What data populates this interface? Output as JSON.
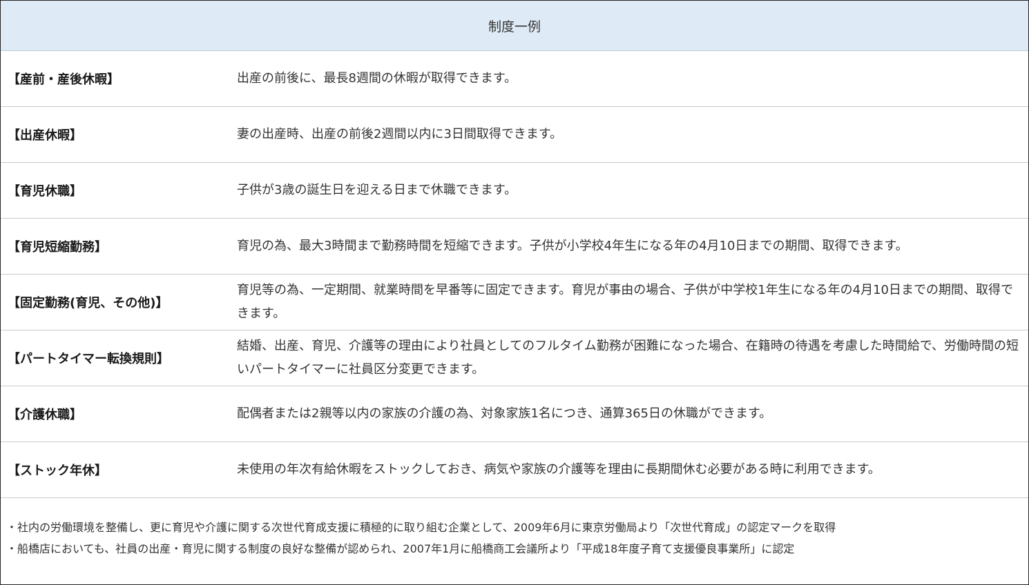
{
  "table": {
    "header": "制度一例",
    "rows": [
      {
        "name": "【産前・産後休暇】",
        "desc": "出産の前後に、最長8週間の休暇が取得できます。"
      },
      {
        "name": "【出産休暇】",
        "desc": "妻の出産時、出産の前後2週間以内に3日間取得できます。"
      },
      {
        "name": "【育児休職】",
        "desc": "子供が3歳の誕生日を迎える日まで休職できます。"
      },
      {
        "name": "【育児短縮勤務】",
        "desc": "育児の為、最大3時間まで勤務時間を短縮できます。子供が小学校4年生になる年の4月10日までの期間、取得できます。"
      },
      {
        "name": "【固定勤務(育児、その他)】",
        "desc": "育児等の為、一定期間、就業時間を早番等に固定できます。育児が事由の場合、子供が中学校1年生になる年の4月10日までの期間、取得できます。"
      },
      {
        "name": "【パートタイマー転換規則】",
        "desc": "結婚、出産、育児、介護等の理由により社員としてのフルタイム勤務が困難になった場合、在籍時の待遇を考慮した時間給で、労働時間の短いパートタイマーに社員区分変更できます。"
      },
      {
        "name": "【介護休職】",
        "desc": "配偶者または2親等以内の家族の介護の為、対象家族1名につき、通算365日の休職ができます。"
      },
      {
        "name": "【ストック年休】",
        "desc": "未使用の年次有給休暇をストックしておき、病気や家族の介護等を理由に長期間休む必要がある時に利用できます。"
      }
    ]
  },
  "notes": [
    "・社内の労働環境を整備し、更に育児や介護に関する次世代育成支援に積極的に取り組む企業として、2009年6月に東京労働局より「次世代育成」の認定マークを取得",
    "・船橋店においても、社員の出産・育児に関する制度の良好な整備が認められ、2007年1月に船橋商工会議所より「平成18年度子育て支援優良事業所」に認定"
  ]
}
